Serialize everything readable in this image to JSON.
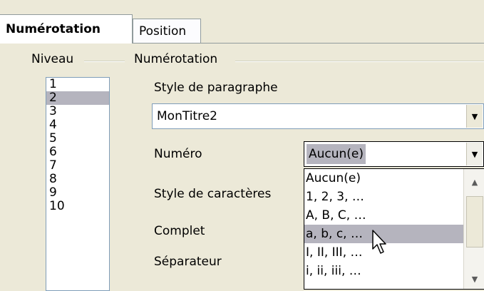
{
  "tabs": [
    {
      "label": "Numérotation",
      "active": true
    },
    {
      "label": "Position",
      "active": false
    }
  ],
  "level_group": {
    "title": "Niveau",
    "items": [
      "1",
      "2",
      "3",
      "4",
      "5",
      "6",
      "7",
      "8",
      "9",
      "10"
    ],
    "selected": "2"
  },
  "numbering_group": {
    "title": "Numérotation",
    "paragraph_style": {
      "label": "Style de paragraphe",
      "value": "MonTitre2"
    },
    "number": {
      "label": "Numéro",
      "value": "Aucun(e)"
    },
    "char_style": {
      "label": "Style de caractères"
    },
    "complete": {
      "label": "Complet"
    },
    "separator": {
      "label": "Séparateur"
    }
  },
  "number_dropdown": {
    "options": [
      "Aucun(e)",
      "1, 2, 3, …",
      "A, B, C, …",
      "a, b, c, …",
      "I, II, III, …",
      "i, ii, iii, …"
    ],
    "highlighted": "a, b, c, …"
  },
  "icons": {
    "dropdown": "chevron-down-icon",
    "scroll_up": "arrow-up-icon",
    "scroll_down": "arrow-down-icon",
    "cursor": "mouse-pointer-icon"
  },
  "colors": {
    "background": "#ece9d8",
    "selection": "#b5b4be",
    "border": "#7f9db9"
  }
}
